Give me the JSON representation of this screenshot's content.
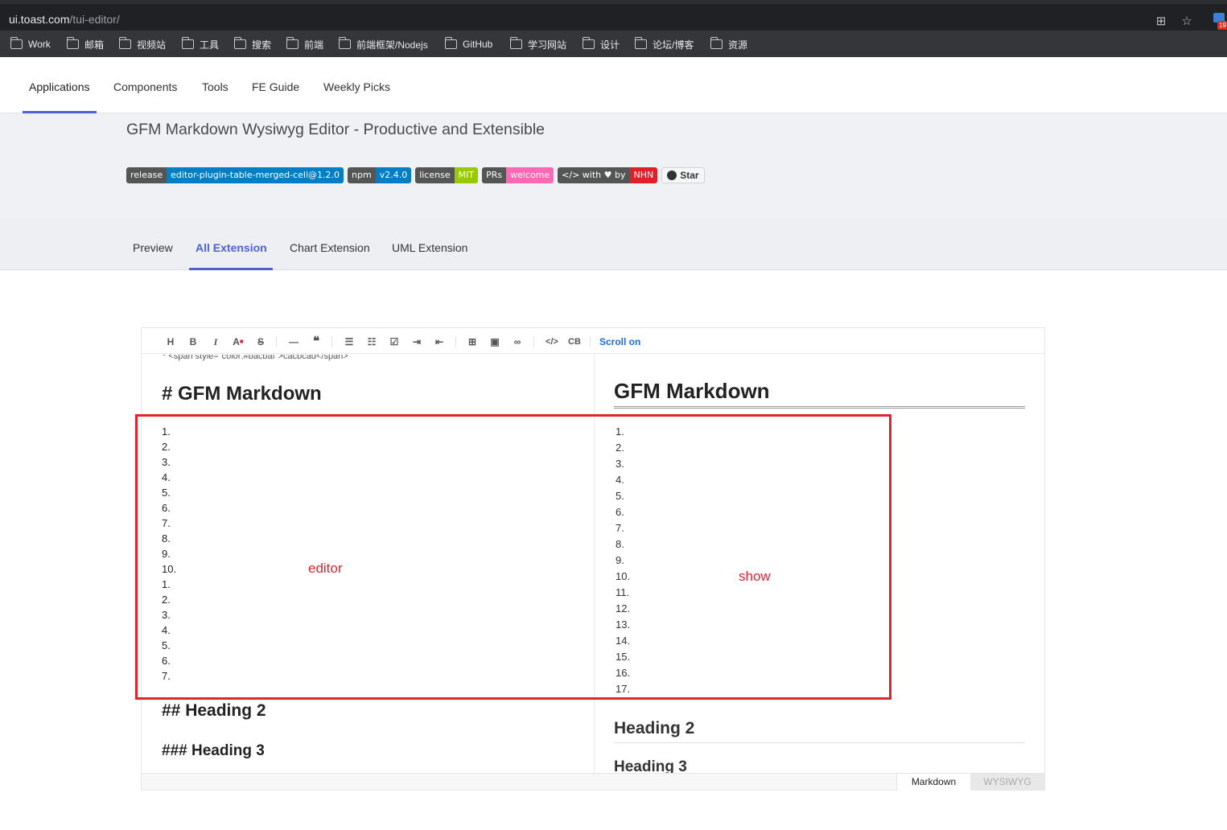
{
  "browser": {
    "url_host": "ui.toast.com",
    "url_path": "/tui-editor/",
    "ext_count": "19",
    "bookmarks": [
      "Work",
      "邮箱",
      "视频站",
      "工具",
      "搜索",
      "前端",
      "前端框架/Nodejs",
      "GitHub",
      "学习网站",
      "设计",
      "论坛/博客",
      "资源"
    ]
  },
  "nav": [
    "Applications",
    "Components",
    "Tools",
    "FE Guide",
    "Weekly Picks"
  ],
  "hero": {
    "title": "GFM Markdown Wysiwyg Editor - Productive and Extensible",
    "badges": [
      {
        "left": "release",
        "right": "editor-plugin-table-merged-cell@1.2.0",
        "color": "#007ec6"
      },
      {
        "left": "npm",
        "right": "v2.4.0",
        "color": "#007ec6"
      },
      {
        "left": "license",
        "right": "MIT",
        "color": "#97ca00"
      },
      {
        "left": "PRs",
        "right": "welcome",
        "color": "#ff69b4"
      },
      {
        "left": "</> with ♥ by",
        "right": "NHN",
        "color": "#e41e26"
      }
    ],
    "star_label": "Star"
  },
  "tabs": [
    "Preview",
    "All Extension",
    "Chart Extension",
    "UML Extension"
  ],
  "toolbar": {
    "icons": [
      "heading-icon",
      "bold-icon",
      "italic-icon",
      "text-color-icon",
      "strike-icon",
      "horizontal-rule-icon",
      "quote-icon",
      "bullet-list-icon",
      "ordered-list-icon",
      "task-list-icon",
      "indent-icon",
      "outdent-icon",
      "table-icon",
      "image-icon",
      "link-icon",
      "code-icon",
      "codeblock-icon"
    ],
    "scroll_label": "Scroll on"
  },
  "editor": {
    "cut_line": "*  <span style=\"color:#bacbaf\">cacbcad</span>",
    "h1": "# GFM Markdown",
    "list": [
      "1.",
      "2.",
      "3.",
      "4.",
      "5.",
      "6.",
      "7.",
      "8.",
      "9.",
      "10.",
      "1.",
      "2.",
      "3.",
      "4.",
      "5.",
      "6.",
      "7."
    ],
    "h2": "## Heading 2",
    "h3": "### Heading 3"
  },
  "preview": {
    "h1": "GFM Markdown",
    "list": [
      "1.",
      "2.",
      "3.",
      "4.",
      "5.",
      "6.",
      "7.",
      "8.",
      "9.",
      "10.",
      "11.",
      "12.",
      "13.",
      "14.",
      "15.",
      "16.",
      "17."
    ],
    "h2": "Heading 2",
    "h3": "Heading 3"
  },
  "modes": {
    "markdown": "Markdown",
    "wysiwyg": "WYSIWYG"
  },
  "annotation": {
    "editor_label": "editor",
    "show_label": "show",
    "color": "#e0242e"
  }
}
